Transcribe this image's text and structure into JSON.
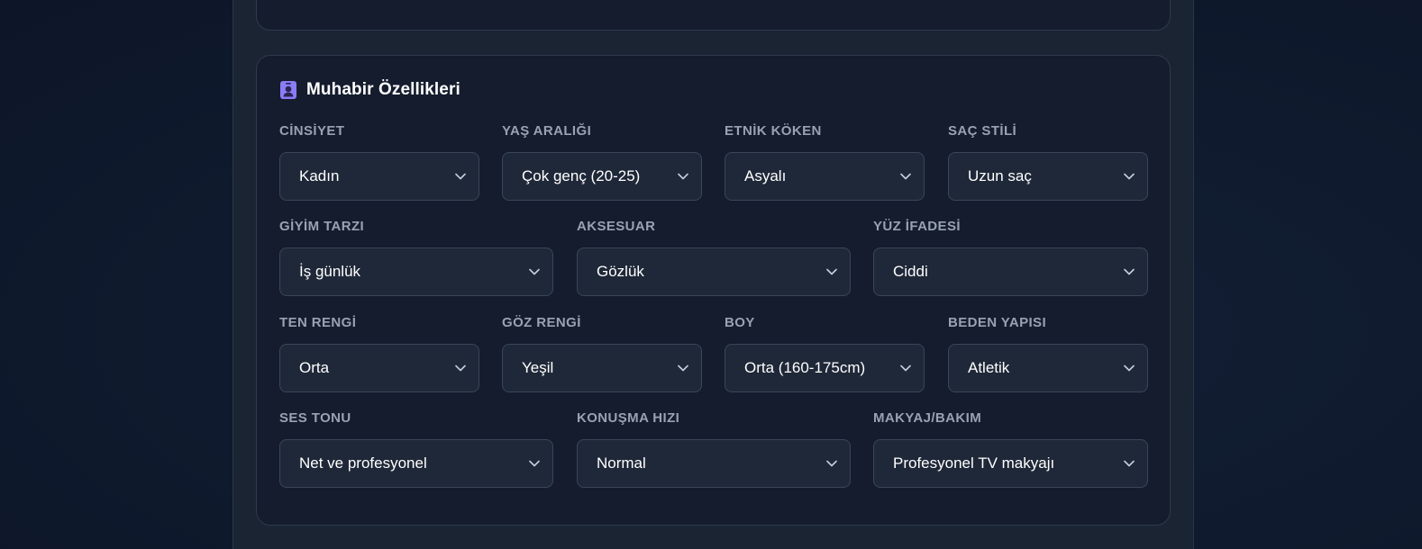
{
  "section": {
    "title": "Muhabir Özellikleri",
    "icon": "id-badge-icon",
    "accent_color": "#8b7cf6"
  },
  "fields": {
    "gender": {
      "label": "CİNSİYET",
      "value": "Kadın"
    },
    "age_range": {
      "label": "YAŞ ARALIĞI",
      "value": "Çok genç (20-25)"
    },
    "ethnicity": {
      "label": "ETNİK KÖKEN",
      "value": "Asyalı"
    },
    "hair_style": {
      "label": "SAÇ STİLİ",
      "value": "Uzun saç"
    },
    "clothing_style": {
      "label": "GİYİM TARZI",
      "value": "İş günlük"
    },
    "accessory": {
      "label": "AKSESUAR",
      "value": "Gözlük"
    },
    "facial_expression": {
      "label": "YÜZ İFADESİ",
      "value": "Ciddi"
    },
    "skin_tone": {
      "label": "TEN RENGİ",
      "value": "Orta"
    },
    "eye_color": {
      "label": "GÖZ RENGİ",
      "value": "Yeşil"
    },
    "height": {
      "label": "BOY",
      "value": "Orta (160-175cm)"
    },
    "body_type": {
      "label": "BEDEN YAPISI",
      "value": "Atletik"
    },
    "voice_tone": {
      "label": "SES TONU",
      "value": "Net ve profesyonel"
    },
    "speech_speed": {
      "label": "KONUŞMA HIZI",
      "value": "Normal"
    },
    "makeup": {
      "label": "MAKYAJ/BAKIM",
      "value": "Profesyonel TV makyajı"
    }
  }
}
